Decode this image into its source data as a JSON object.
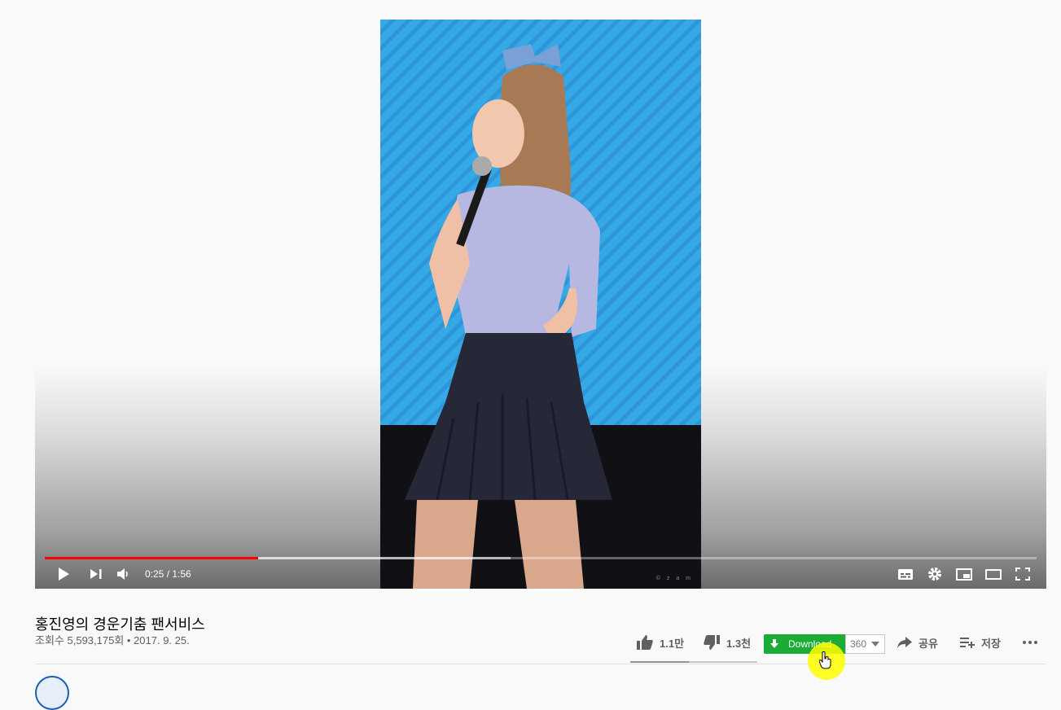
{
  "player": {
    "time_current": "0:25",
    "time_separator": " / ",
    "time_total": "1:56",
    "progress_played_fraction": 0.215,
    "progress_buffered_fraction": 0.47,
    "watermark": "© z a m"
  },
  "video": {
    "title": "홍진영의 경운기춤 팬서비스",
    "view_info": "조회수 5,593,175회 • 2017. 9. 25."
  },
  "actions": {
    "like_count": "1.1만",
    "dislike_count": "1.3천",
    "download_label": "Download",
    "quality_value": "360",
    "share_label": "공유",
    "save_label": "저장",
    "like_fraction": 0.46
  },
  "colors": {
    "progress_played": "#ff0000",
    "download_green": "#1aac35",
    "cursor_highlight": "#ffff00"
  },
  "icons": {
    "play": "play-icon",
    "next": "next-icon",
    "volume": "volume-icon",
    "subtitles": "subtitles-icon",
    "settings": "gear-icon",
    "miniplayer": "miniplayer-icon",
    "theater": "theater-icon",
    "fullscreen": "fullscreen-icon",
    "like": "thumbs-up-icon",
    "dislike": "thumbs-down-icon",
    "share": "share-arrow-icon",
    "save": "playlist-add-icon",
    "more": "more-horiz-icon"
  }
}
